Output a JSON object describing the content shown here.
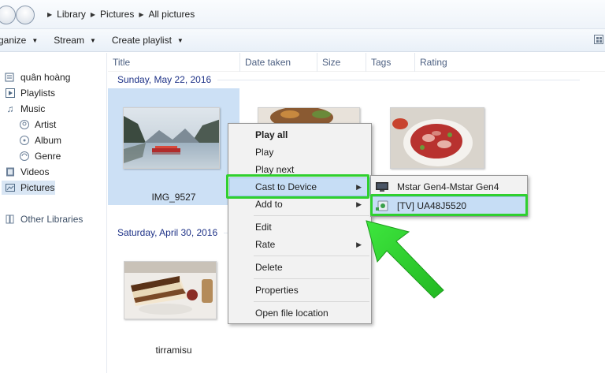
{
  "address": {
    "crumbs": [
      "Library",
      "Pictures",
      "All pictures"
    ]
  },
  "toolbar": {
    "organize": "rganize",
    "stream": "Stream",
    "create_playlist": "Create playlist"
  },
  "sidebar": {
    "user": "quân hoàng",
    "playlists": "Playlists",
    "music": "Music",
    "artist": "Artist",
    "album": "Album",
    "genre": "Genre",
    "videos": "Videos",
    "pictures": "Pictures",
    "other_libraries": "Other Libraries"
  },
  "columns": [
    "Title",
    "Date taken",
    "Size",
    "Tags",
    "Rating"
  ],
  "groups": {
    "g1": "Sunday, May 22, 2016",
    "g2": "Saturday, April 30, 2016"
  },
  "items": {
    "img1_caption": "IMG_9527",
    "img4_caption": "tirramisu"
  },
  "context_menu": {
    "play_all": "Play all",
    "play": "Play",
    "play_next": "Play next",
    "cast_to_device": "Cast to Device",
    "add_to": "Add to",
    "edit": "Edit",
    "rate": "Rate",
    "delete": "Delete",
    "properties": "Properties",
    "open_file_location": "Open file location"
  },
  "cast_submenu": {
    "device1": "Mstar Gen4-Mstar Gen4",
    "device2": "[TV] UA48J5520"
  },
  "colors": {
    "highlight": "#c6ddf5",
    "annotation_green": "#2fd02f",
    "selection": "#cce0f5"
  }
}
